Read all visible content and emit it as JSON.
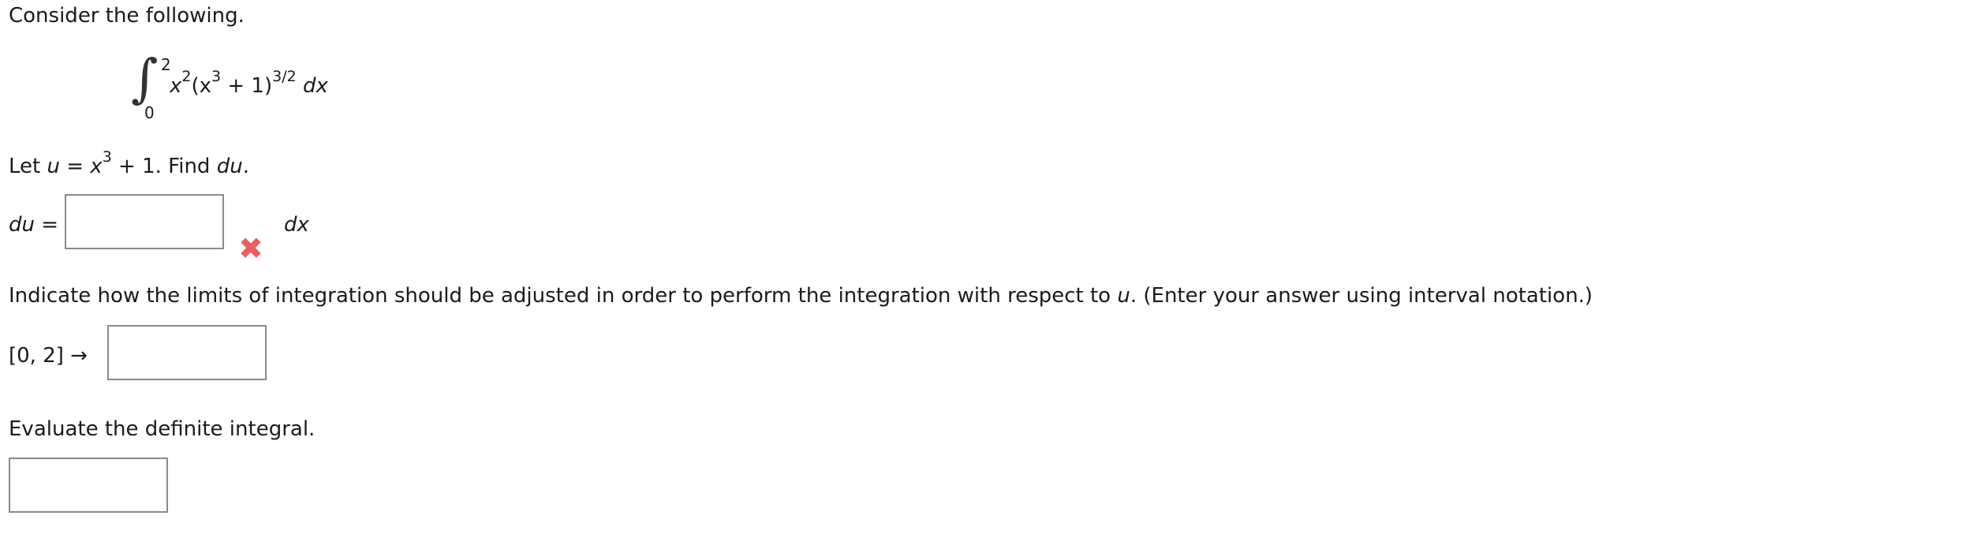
{
  "intro": "Consider the following.",
  "integral": {
    "upper": "2",
    "lower": "0",
    "integrand": {
      "a": "x",
      "a_exp": "2",
      "b": "(x",
      "b_exp": "3",
      "c": " + 1)",
      "c_exp": "3/2",
      "d": "dx"
    }
  },
  "q1": {
    "let": "Let ",
    "u": "u",
    "eq": " = ",
    "x": "x",
    "exp": "3",
    "rest": " + 1. Find ",
    "du": "du",
    "end": ".",
    "answer_label": "du",
    "answer_eq": "=",
    "answer_value": "",
    "suffix": "dx",
    "status": "incorrect",
    "status_glyph": "✖",
    "status_color": "#e86060"
  },
  "q2": {
    "text_before": "Indicate how the limits of integration should be adjusted in order to perform the integration with respect to ",
    "var": "u",
    "text_after": ". (Enter your answer using interval notation.)",
    "interval": "[0, 2]",
    "arrow": "→",
    "answer_value": ""
  },
  "q3": {
    "text": "Evaluate the definite integral.",
    "answer_value": ""
  }
}
